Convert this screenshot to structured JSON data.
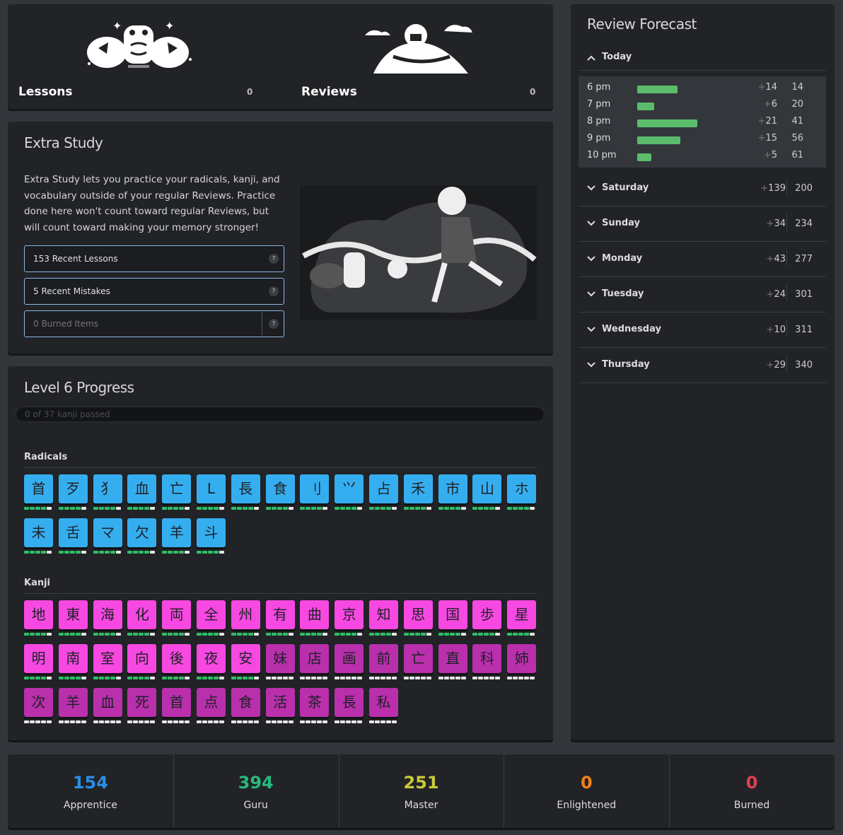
{
  "lessons": {
    "title": "Lessons",
    "count": "0"
  },
  "reviews": {
    "title": "Reviews",
    "count": "0"
  },
  "extra_study": {
    "title": "Extra Study",
    "description": "Extra Study lets you practice your radicals, kanji, and vocabulary outside of your regular Reviews. Practice done here won't count toward regular Reviews, but will count toward making your memory stronger!",
    "buttons": [
      {
        "label": "153 Recent Lessons",
        "help": "?"
      },
      {
        "label": "5 Recent Mistakes",
        "help": "?"
      },
      {
        "label": "0 Burned Items",
        "help": "?"
      }
    ]
  },
  "level_progress": {
    "title": "Level 6 Progress",
    "progress_text": "0 of 37 kanji passed",
    "progress_fraction": 0,
    "radicals_label": "Radicals",
    "kanji_label": "Kanji",
    "radicals": [
      "首",
      "歹",
      "犭",
      "血",
      "亡",
      "L",
      "長",
      "食",
      "刂",
      "⺍",
      "占",
      "禾",
      "市",
      "山",
      "ホ",
      "未",
      "舌",
      "マ",
      "欠",
      "羊",
      "斗"
    ],
    "kanji_unlocked": [
      "地",
      "東",
      "海",
      "化",
      "両",
      "全",
      "州",
      "有",
      "曲",
      "京",
      "知",
      "思",
      "国",
      "歩",
      "星",
      "明",
      "南",
      "室",
      "向",
      "後",
      "夜",
      "安"
    ],
    "kanji_locked": [
      "妹",
      "店",
      "画",
      "前",
      "亡",
      "直",
      "科",
      "姉",
      "次",
      "羊",
      "血",
      "死",
      "首",
      "点",
      "食",
      "活",
      "茶",
      "長",
      "私"
    ]
  },
  "forecast": {
    "title": "Review Forecast",
    "today": {
      "label": "Today",
      "hours": [
        {
          "time": "6 pm",
          "add": "14",
          "total": "14",
          "count": 14
        },
        {
          "time": "7 pm",
          "add": "6",
          "total": "20",
          "count": 6
        },
        {
          "time": "8 pm",
          "add": "21",
          "total": "41",
          "count": 21
        },
        {
          "time": "9 pm",
          "add": "15",
          "total": "56",
          "count": 15
        },
        {
          "time": "10 pm",
          "add": "5",
          "total": "61",
          "count": 5
        }
      ]
    },
    "days": [
      {
        "name": "Saturday",
        "add": "139",
        "total": "200"
      },
      {
        "name": "Sunday",
        "add": "34",
        "total": "234"
      },
      {
        "name": "Monday",
        "add": "43",
        "total": "277"
      },
      {
        "name": "Tuesday",
        "add": "24",
        "total": "301"
      },
      {
        "name": "Wednesday",
        "add": "10",
        "total": "311"
      },
      {
        "name": "Thursday",
        "add": "29",
        "total": "340"
      }
    ]
  },
  "srs": [
    {
      "count": "154",
      "label": "Apprentice",
      "color": "#2a8ee8"
    },
    {
      "count": "394",
      "label": "Guru",
      "color": "#29b87c"
    },
    {
      "count": "251",
      "label": "Master",
      "color": "#c9c93a"
    },
    {
      "count": "0",
      "label": "Enlightened",
      "color": "#f07f1d"
    },
    {
      "count": "0",
      "label": "Burned",
      "color": "#e0404e"
    }
  ]
}
